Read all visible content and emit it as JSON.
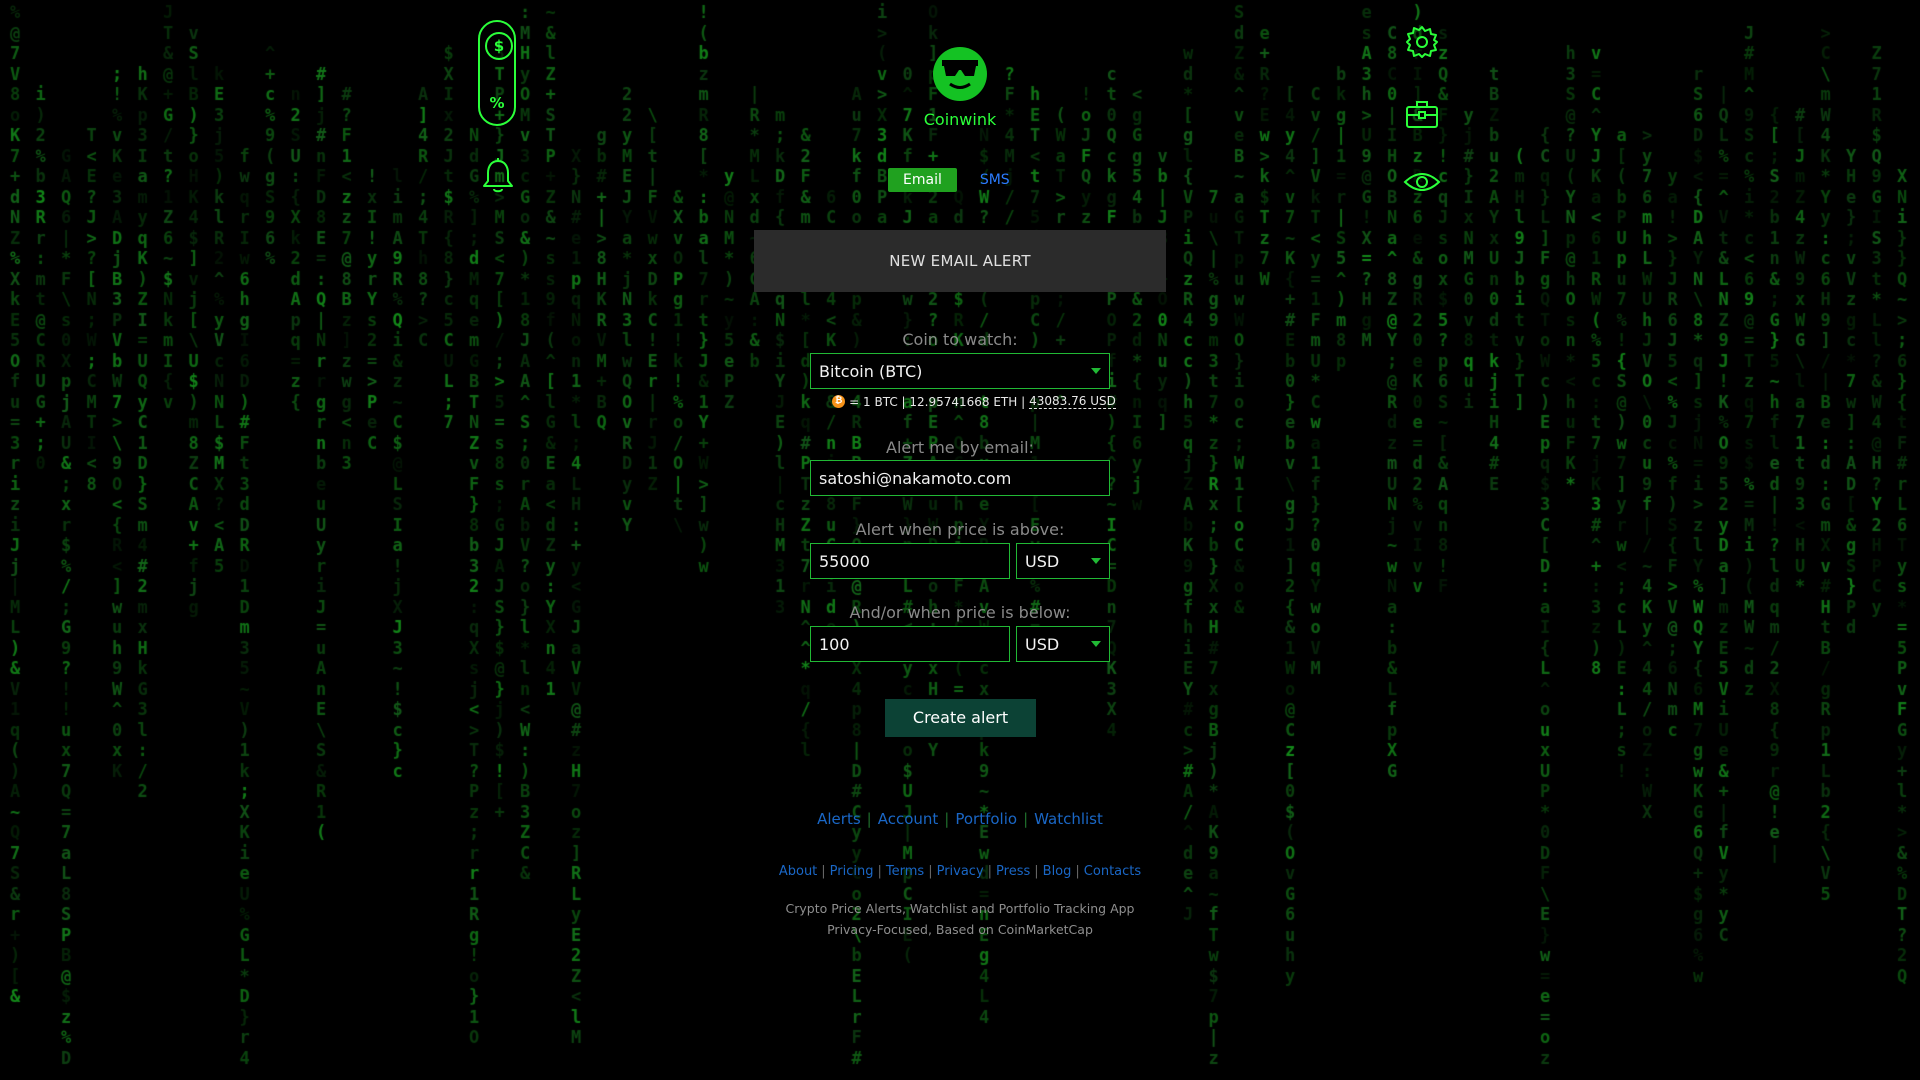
{
  "app": {
    "name": "Coinwink"
  },
  "colors": {
    "accent": "#2bff3a",
    "tab_active_bg": "#20a11f",
    "link": "#1a67c6",
    "button_bg": "#0c4235",
    "background": "#000000"
  },
  "left_icons": {
    "price_pill_dollar": "$",
    "price_pill_percent": "%",
    "bell": "bell-icon"
  },
  "right_icons": [
    "gear-icon",
    "briefcase-icon",
    "eye-icon"
  ],
  "tabs": [
    {
      "label": "Email",
      "active": true
    },
    {
      "label": "SMS",
      "active": false
    }
  ],
  "panel": {
    "title": "NEW EMAIL ALERT"
  },
  "form": {
    "coin_label": "Coin to watch:",
    "coin_value": "Bitcoin (BTC)",
    "rate": {
      "prefix": "= 1 BTC | 12.95741668 ETH |",
      "usd": "43083.76 USD"
    },
    "email_label": "Alert me by email:",
    "email_value": "satoshi@nakamoto.com",
    "above_label": "Alert when price is above:",
    "above_value": "55000",
    "above_currency": "USD",
    "below_label": "And/or when price is below:",
    "below_value": "100",
    "below_currency": "USD",
    "submit_label": "Create alert"
  },
  "nav_primary": [
    "Alerts",
    "Account",
    "Portfolio",
    "Watchlist"
  ],
  "nav_secondary": [
    "About",
    "Pricing",
    "Terms",
    "Privacy",
    "Press",
    "Blog",
    "Contacts"
  ],
  "tagline": [
    "Crypto Price Alerts, Watchlist and Portfolio Tracking App",
    "Privacy-Focused, Based on CoinMarketCap"
  ]
}
